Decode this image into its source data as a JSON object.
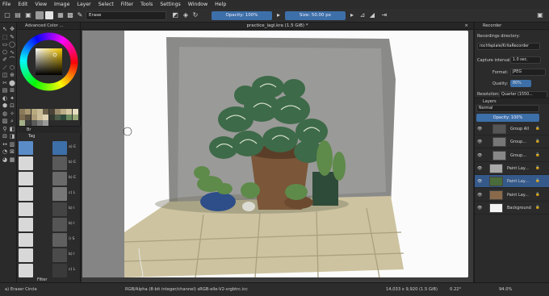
{
  "menu": [
    "File",
    "Edit",
    "View",
    "Image",
    "Layer",
    "Select",
    "Filter",
    "Tools",
    "Settings",
    "Window",
    "Help"
  ],
  "toolbar": {
    "blend_mode": "Erase",
    "opacity": "Opacity: 100%",
    "size": "Size: 50.00 px",
    "opacity_level": 1.0
  },
  "document_tab": "practice_lagi.kra (1.5 GiB) *",
  "left_panel": {
    "color_title": "Advanced Color ...",
    "brush_tab": "Br",
    "tag_label": "Tag",
    "filter_label": "Filter"
  },
  "brush_labels": [
    "a) E",
    "b) E",
    "b) E",
    "c) L",
    "b) I",
    "b) I",
    "i) S",
    "b) I",
    "c) L"
  ],
  "recorder": {
    "title": "Recorder",
    "dir_label": "Recordings directory:",
    "dir_value": "rochfaplaie/KritaRecorder",
    "interval_label": "Capture interval:",
    "interval_value": "1.0 sec.",
    "format_label": "Format:",
    "format_value": "JPEG",
    "quality_label": "Quality:",
    "quality_value": "80%",
    "resolution_label": "Resolution:",
    "resolution_value": "Quarter (1550..."
  },
  "layers": {
    "title": "Layers",
    "blend": "Normal",
    "opacity": "Opacity: 100%",
    "items": [
      {
        "name": "Group All"
      },
      {
        "name": "Group..."
      },
      {
        "name": "Group..."
      },
      {
        "name": "Paint Lay..."
      },
      {
        "name": "Paint Lay..."
      },
      {
        "name": "Paint Lay..."
      },
      {
        "name": "Background"
      }
    ]
  },
  "status": {
    "brush": "a) Eraser Circle",
    "color_space": "RGB/Alpha (8-bit integer/channel)  sRGB-elle-V2-srgbtrc.icc",
    "dimensions": "14,033 x 9,920 (1.5 GiB)",
    "rotation": "0.22°",
    "zoom": "94.0%"
  },
  "colors": {
    "accent": "#3d6fa8",
    "selected_layer": "#35598a",
    "panel": "#2b2b2b"
  },
  "palette": [
    "#8a7a5a",
    "#a89870",
    "#b8aa80",
    "#c8bc96",
    "#6a6048",
    "#4a4438",
    "#9a8c6c",
    "#bcae88",
    "#d6caa4",
    "#e6ddc0",
    "#7c6c50",
    "#5c5040",
    "#ac9c78",
    "#ccbe98",
    "#ded4b4",
    "#343a30",
    "#4c5c48",
    "#2e4a3a",
    "#6c8c60",
    "#98a878",
    "#a4b088",
    "#3a3a3a",
    "#5a5a5a",
    "#7a7a7a",
    "#9a9a9a"
  ]
}
